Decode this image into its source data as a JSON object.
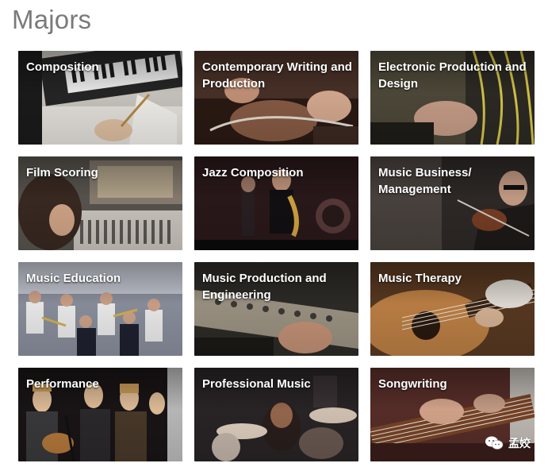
{
  "page": {
    "title": "Majors"
  },
  "majors": [
    {
      "label": "Composition",
      "icon": "piano-keyboard-photo",
      "bg": "#c9c6c1",
      "accent": "#1e1e1e"
    },
    {
      "label": "Contemporary Writing and Production",
      "icon": "guitar-hands-photo",
      "bg": "#5a3b2e",
      "accent": "#2a1712"
    },
    {
      "label": "Electronic Production and Design",
      "icon": "synth-cables-photo",
      "bg": "#6a5d38",
      "accent": "#d6c54a"
    },
    {
      "label": "Film Scoring",
      "icon": "mixing-console-photo",
      "bg": "#4d4a45",
      "accent": "#9a8f80"
    },
    {
      "label": "Jazz Composition",
      "icon": "saxophone-stage-photo",
      "bg": "#2b1a1c",
      "accent": "#b9473a"
    },
    {
      "label": "Music Business/ Management",
      "icon": "violinist-photo",
      "bg": "#3a3330",
      "accent": "#7a6c5f"
    },
    {
      "label": "Music Education",
      "icon": "band-classroom-photo",
      "bg": "#5a5f6e",
      "accent": "#c9cbd3"
    },
    {
      "label": "Music Production and Engineering",
      "icon": "studio-console-photo",
      "bg": "#38362f",
      "accent": "#8f8775"
    },
    {
      "label": "Music Therapy",
      "icon": "acoustic-guitar-photo",
      "bg": "#7a4b28",
      "accent": "#d7a66a"
    },
    {
      "label": "Performance",
      "icon": "singers-stage-photo",
      "bg": "#231d1e",
      "accent": "#c98f4d"
    },
    {
      "label": "Professional Music",
      "icon": "drummer-photo",
      "bg": "#2b2628",
      "accent": "#b68f74"
    },
    {
      "label": "Songwriting",
      "icon": "guitar-closeup-photo",
      "bg": "#6b3a30",
      "accent": "#d8b3a0"
    }
  ],
  "watermark": {
    "text": "孟姣",
    "icon": "wechat-icon"
  }
}
